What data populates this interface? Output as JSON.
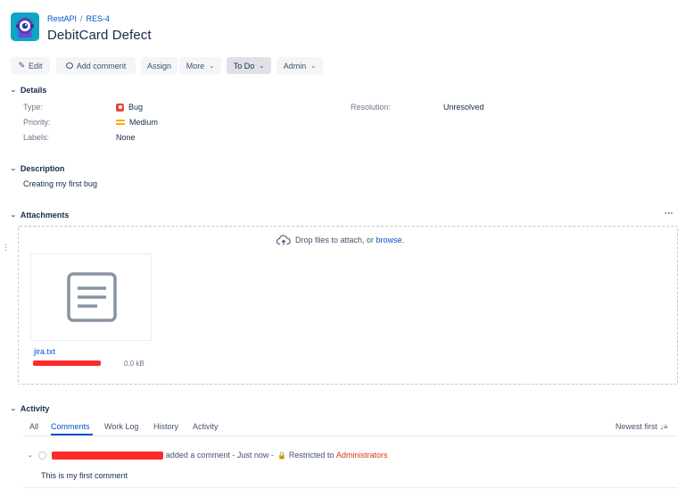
{
  "breadcrumb": {
    "project": "RestAPI",
    "separator": "/",
    "issue_key": "RES-4"
  },
  "issue": {
    "title": "DebitCard Defect"
  },
  "toolbar": {
    "edit": "Edit",
    "add_comment": "Add comment",
    "assign": "Assign",
    "more": "More",
    "status": "To Do",
    "admin": "Admin"
  },
  "details": {
    "heading": "Details",
    "type_label": "Type:",
    "type_value": "Bug",
    "priority_label": "Priority:",
    "priority_value": "Medium",
    "labels_label": "Labels:",
    "labels_value": "None",
    "resolution_label": "Resolution:",
    "resolution_value": "Unresolved"
  },
  "description": {
    "heading": "Description",
    "text": "Creating my first bug"
  },
  "attachments": {
    "heading": "Attachments",
    "menu": "···",
    "drop_text": "Drop files to attach, or",
    "browse": "browse.",
    "file": {
      "name": "jira.txt",
      "size": "0.0 kB"
    }
  },
  "activity": {
    "heading": "Activity",
    "tabs": [
      "All",
      "Comments",
      "Work Log",
      "History",
      "Activity"
    ],
    "active_tab": "Comments",
    "sort": "Newest first",
    "comment": {
      "action": "added a comment - Just now -",
      "restricted": "Restricted to",
      "group": "Administrators",
      "body": "This is my first comment"
    }
  },
  "colors": {
    "link": "#0052cc",
    "bug": "#e5493a",
    "priority": "#ffab00",
    "redaction": "#ff2a2a",
    "restricted_group": "#de350b"
  }
}
